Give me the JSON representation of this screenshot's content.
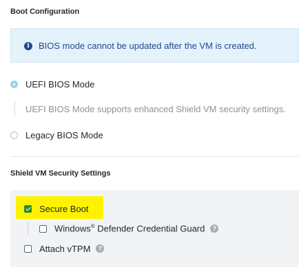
{
  "boot_config": {
    "title": "Boot Configuration",
    "info_icon": "info-icon",
    "info_text": "BIOS mode cannot be updated after the VM is created.",
    "options": [
      {
        "label": "UEFI BIOS Mode",
        "selected": true
      },
      {
        "label": "Legacy BIOS Mode",
        "selected": false
      }
    ],
    "uefi_description": "UEFI BIOS Mode supports enhanced Shield VM security settings."
  },
  "shield": {
    "title": "Shield VM Security Settings",
    "secure_boot": {
      "label": "Secure Boot",
      "checked": true
    },
    "defender": {
      "label_pre": "Windows",
      "reg_mark": "®",
      "label_post": " Defender Credential Guard",
      "checked": false,
      "help_icon": "help-icon"
    },
    "vtpm": {
      "label": "Attach vTPM",
      "checked": false,
      "help_icon": "help-icon"
    }
  },
  "colors": {
    "info_bg": "#e3f2fb",
    "info_text": "#22488e",
    "highlight": "#fff200",
    "checkbox_checked": "#2c8a2c",
    "radio_selected": "#9fd2f0"
  },
  "glyphs": {
    "info": "i",
    "help": "?"
  }
}
